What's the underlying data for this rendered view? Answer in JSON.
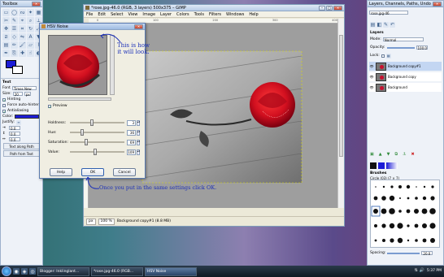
{
  "toolbox": {
    "title": "Toolbox",
    "text_tool_label": "Text",
    "font_label": "Font",
    "font_value": "Times New",
    "size_label": "Size:",
    "size_value": "20",
    "size_unit": "px",
    "hinting_label": "Hinting",
    "force_autohinter_label": "Force auto-hinter",
    "antialiasing_label": "Antialiasing",
    "color_label": "Color:",
    "justify_label": "Justify:",
    "indent_value_1": "0.0",
    "indent_value_2": "0.0",
    "indent_value_3": "0.0",
    "text_along_path": "Text along Path",
    "path_from_text": "Path from Text"
  },
  "gimp": {
    "title": "*rose.jpg-46.0 (RGB, 3 layers) 500x375 – GIMP",
    "menus": [
      "File",
      "Edit",
      "Select",
      "View",
      "Image",
      "Layer",
      "Colors",
      "Tools",
      "Filters",
      "Windows",
      "Help"
    ],
    "ruler_ticks": [
      "0",
      "100",
      "200",
      "300",
      "400"
    ],
    "unit": "px",
    "zoom": "100 %",
    "status": "Background copy#1 (8.8 MB)"
  },
  "hsv_dialog": {
    "title": "HSV Noise",
    "preview_label": "Preview",
    "preview_checked": true,
    "holdness_label": "Holdness:",
    "holdness_value": "3",
    "hue_label": "Hue:",
    "hue_value": "36",
    "saturation_label": "Saturation:",
    "saturation_value": "69",
    "value_label": "Value:",
    "value_value": "109",
    "help": "Help",
    "ok": "OK",
    "cancel": "Cancel"
  },
  "annotations": {
    "preview_note": "This is how it will look.",
    "ok_note": "Once you put in the same settings click OK."
  },
  "layers": {
    "title": "Layers, Channels, Paths, Undo - Br...",
    "image_select": "rose.jpg-46",
    "tab_label": "Layers",
    "mode_label": "Mode:",
    "mode_value": "Normal",
    "opacity_label": "Opacity:",
    "opacity_value": "100.0",
    "lock_label": "Lock:",
    "items": [
      "Background copy#1",
      "Background copy",
      "Background"
    ],
    "brushes_label": "Brushes",
    "brush_name": "Circle (03) (7 × 7)",
    "spacing_label": "Spacing:",
    "spacing_value": "20.0"
  },
  "taskbar": {
    "items": [
      "Blogger: Inklinglant...",
      "*rose.jpg-46.0 (RGB...",
      "HSV Noise"
    ],
    "clock": "5:37 PM"
  }
}
